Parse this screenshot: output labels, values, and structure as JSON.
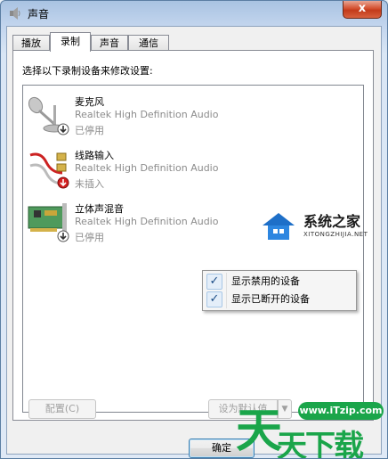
{
  "window": {
    "title": "声音",
    "close_glyph": "x"
  },
  "tabs": [
    {
      "label": "播放"
    },
    {
      "label": "录制"
    },
    {
      "label": "声音"
    },
    {
      "label": "通信"
    }
  ],
  "active_tab": "录制",
  "instruction": "选择以下录制设备来修改设置:",
  "devices": [
    {
      "name": "麦克风",
      "description": "Realtek High Definition Audio",
      "state": "已停用",
      "icon": "microphone-icon",
      "badge": "disabled-arrow-badge"
    },
    {
      "name": "线路输入",
      "description": "Realtek High Definition Audio",
      "state": "未插入",
      "icon": "line-in-cable-icon",
      "badge": "unplugged-red-badge"
    },
    {
      "name": "立体声混音",
      "description": "Realtek High Definition Audio",
      "state": "已停用",
      "icon": "sound-card-icon",
      "badge": "disabled-arrow-badge"
    }
  ],
  "context_menu": {
    "items": [
      {
        "label": "显示禁用的设备",
        "checked": true
      },
      {
        "label": "显示已断开的设备",
        "checked": true
      }
    ],
    "check_glyph": "✓"
  },
  "buttons": {
    "configure": "配置(C)",
    "set_default": "设为默认值",
    "set_default_arrow": "▼",
    "ok": "确定"
  },
  "watermarks": {
    "xitong_title": "系统之家",
    "xitong_sub": "XITONGZHIJIA.NET",
    "itzip_url": "www.iTzip.com",
    "itzip_brand": "天下载",
    "itzip_char": "天"
  },
  "colors": {
    "accent_green": "#1aa54a",
    "close_red": "#c23a1a",
    "unplugged_red": "#d42020"
  }
}
